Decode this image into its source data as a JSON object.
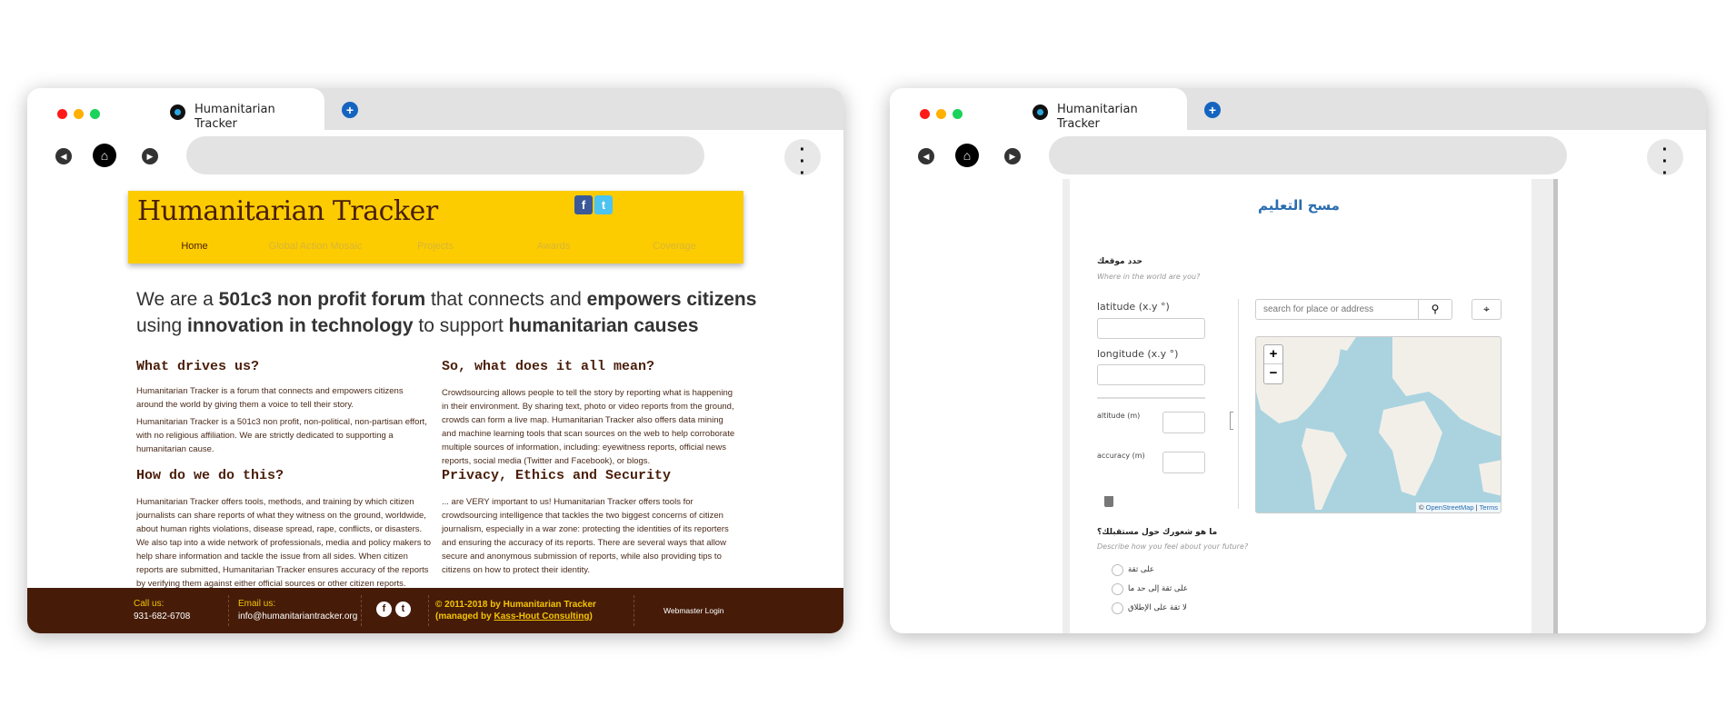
{
  "browser": {
    "tab_title": "Humanitarian Tracker",
    "new_tab": "+",
    "back": "◀",
    "home": "⌂",
    "forward": "▶",
    "menu": "⋮"
  },
  "left": {
    "brand": "Humanitarian Tracker",
    "social": {
      "facebook": "f",
      "twitter": "t"
    },
    "nav": [
      "Home",
      "Global Action Mosaic",
      "Projects",
      "Awards",
      "Coverage"
    ],
    "headline": {
      "p1": "We are a ",
      "b1": "501c3 non profit forum",
      "p2": " that connects and ",
      "b2": "empowers citizens",
      "p3": "using ",
      "b3": "innovation in technology",
      "p4": " to support ",
      "b4": "humanitarian causes"
    },
    "sections": [
      {
        "title": "What drives us?",
        "paras": [
          "Humanitarian Tracker is a forum that connects and empowers citizens around the world by giving them a voice to tell their story.",
          "Humanitarian Tracker is a 501c3 non profit, non-political, non-partisan effort, with no religious affiliation. We are strictly dedicated to supporting a humanitarian cause."
        ]
      },
      {
        "title": "So, what does it all mean?",
        "paras": [
          "Crowdsourcing allows people to tell the story by reporting what is happening in their environment.  By sharing text, photo or video reports from the ground, crowds can form a live map. Humanitarian Tracker also offers data mining and machine learning tools that scan sources on the web to help corroborate multiple sources of information, including: eyewitness reports, official news reports, social media (Twitter and Facebook), or blogs."
        ]
      },
      {
        "title": "How do we do this?",
        "paras": [
          "Humanitarian Tracker offers tools, methods, and training by which citizen journalists can share reports of what they witness on the ground, worldwide, about human rights violations, disease spread, rape, conflicts, or disasters. We also tap into a wide network of professionals, media and policy makers to help share information and tackle the issue from all sides. When citizen reports are submitted, Humanitarian Tracker ensures accuracy of the reports by verifying them against either official sources or other citizen reports."
        ]
      },
      {
        "title": "Privacy, Ethics and Security",
        "paras": [
          "... are VERY important to us! Humanitarian Tracker offers tools for crowdsourcing intelligence that tackles the two biggest concerns of citizen journalism, especially in a war zone: protecting the identities of its reporters and ensuring the accuracy of its reports. There are several ways that allow secure and anonymous submission of reports, while also providing tips to citizens on how to protect their identity."
        ]
      }
    ],
    "footer": {
      "call_label": "Call us:",
      "phone": "931-682-6708",
      "email_label": "Email us:",
      "email": "info@humanitariantracker.org",
      "copyright": "© 2011-2018 by Humanitarian Tracker (managed by ",
      "consulting": "Kass-Hout Consulting",
      "close": ")",
      "webmaster": "Webmaster Login"
    }
  },
  "right": {
    "title": "مسح التعليم",
    "location_q": "حدد موقعك",
    "location_hint": "Where in the world are you?",
    "latitude": "latitude (x.y °)",
    "longitude": "longitude (x.y °)",
    "altitude": "altitude (m)",
    "accuracy": "accuracy (m)",
    "search_placeholder": "search for place or address",
    "zoom_in": "+",
    "zoom_out": "−",
    "attribution": {
      "osm": "OpenStreetMap",
      "terms": "Terms",
      "sep": "|",
      "c": "©"
    },
    "future_q": "ما هو شعورك حول مستقبلك؟",
    "future_hint": "Describe how you feel about your future?",
    "options": [
      "على ثقة",
      "على ثقة إلى حد ما",
      "لا ثقة على الإطلاق"
    ]
  },
  "colors": {
    "yellow": "#fccc00",
    "brown": "#461c09",
    "link": "#2a6db0",
    "map_water": "#aad3df",
    "map_land": "#f2efe9"
  }
}
